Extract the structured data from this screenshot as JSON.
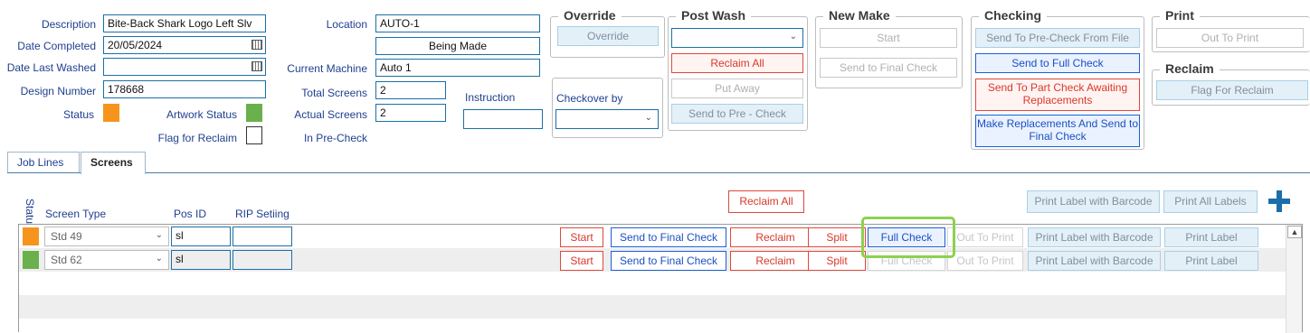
{
  "form": {
    "description_label": "Description",
    "description_value": "Bite-Back Shark Logo Left Slv",
    "date_completed_label": "Date Completed",
    "date_completed_value": "20/05/2024",
    "date_last_washed_label": "Date Last Washed",
    "date_last_washed_value": "",
    "design_number_label": "Design Number",
    "design_number_value": "178668",
    "status_label": "Status",
    "artwork_status_label": "Artwork Status",
    "flag_reclaim_label": "Flag for Reclaim",
    "location_label": "Location",
    "location_value": "AUTO-1",
    "being_made_value": "Being Made",
    "current_machine_label": "Current Machine",
    "current_machine_value": "Auto 1",
    "total_screens_label": "Total Screens",
    "total_screens_value": "2",
    "actual_screens_label": "Actual Screens",
    "actual_screens_value": "2",
    "in_precheck_label": "In Pre-Check",
    "instruction_label": "Instruction",
    "instruction_value": "",
    "checkover_label": "Checkover by",
    "checkover_value": ""
  },
  "colors": {
    "status": "#f7941d",
    "artwork_status": "#6ab04c"
  },
  "groups": {
    "override": {
      "title": "Override",
      "btn": "Override"
    },
    "postwash": {
      "title": "Post Wash",
      "select_value": "",
      "reclaim_all": "Reclaim All",
      "put_away": "Put Away",
      "send_precheck": "Send to Pre - Check"
    },
    "newmake": {
      "title": "New Make",
      "start": "Start",
      "send_final": "Send to Final Check"
    },
    "checking": {
      "title": "Checking",
      "precheck_file": "Send To Pre-Check From File",
      "full_check": "Send to Full Check",
      "part_check": "Send To Part Check Awaiting Replacements",
      "make_repl": "Make Replacements And Send to Final Check"
    },
    "print": {
      "title": "Print",
      "out_to_print": "Out To Print"
    },
    "reclaim": {
      "title": "Reclaim",
      "flag": "Flag For Reclaim"
    }
  },
  "tabs": [
    "Job Lines",
    "Screens"
  ],
  "screens": {
    "status_header": "Status",
    "col_screen_type": "Screen Type",
    "col_pos_id": "Pos ID",
    "col_rip": "RIP Setiing",
    "reclaim_all": "Reclaim All",
    "print_label_barcode": "Print Label with Barcode",
    "print_all_labels": "Print All Labels",
    "rows": [
      {
        "status_color": "#f7941d",
        "screen_type": "Std 49",
        "pos_id": "sl",
        "rip": "",
        "start": "Start",
        "send_final": "Send to Final Check",
        "reclaim": "Reclaim",
        "split": "Split",
        "full_check": "Full Check",
        "out_to_print": "Out To Print",
        "print_label_barcode": "Print Label with Barcode",
        "print_label": "Print Label"
      },
      {
        "status_color": "#6ab04c",
        "screen_type": "Std 62",
        "pos_id": "sl",
        "rip": "",
        "start": "Start",
        "send_final": "Send to Final Check",
        "reclaim": "Reclaim",
        "split": "Split",
        "full_check": "Full Check",
        "out_to_print": "Out To Print",
        "print_label_barcode": "Print Label with Barcode",
        "print_label": "Print Label"
      }
    ]
  }
}
